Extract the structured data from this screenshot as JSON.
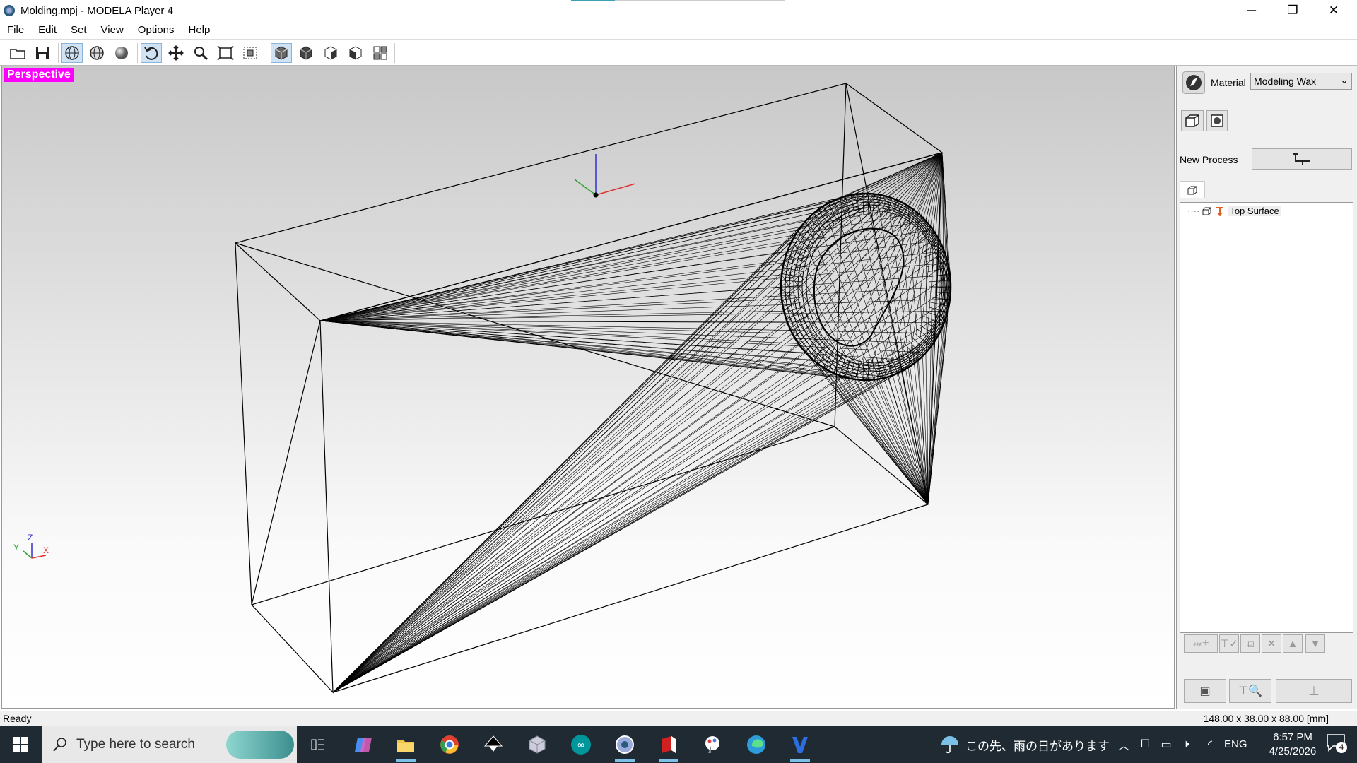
{
  "window": {
    "title": "Molding.mpj - MODELA Player 4",
    "minimize": "─",
    "restore": "❐",
    "close": "✕"
  },
  "menu": [
    "File",
    "Edit",
    "Set",
    "View",
    "Options",
    "Help"
  ],
  "toolbar": {
    "icons": [
      "open-folder-icon",
      "save-icon",
      "wireframe-icon",
      "hidden-line-icon",
      "shaded-icon",
      "rotate-icon",
      "pan-icon",
      "zoom-icon",
      "fit-view-icon",
      "zoom-window-icon",
      "view-front-icon",
      "view-side-icon",
      "view-back-icon",
      "view-other-icon",
      "multi-view-icon"
    ]
  },
  "viewport": {
    "mode_label": "Perspective",
    "axis_labels": {
      "y": "Y",
      "z": "Z",
      "x": "X"
    }
  },
  "panel": {
    "material_label": "Material",
    "material_value": "Modeling Wax",
    "new_process_label": "New Process",
    "process_tree": [
      {
        "label": "Top Surface"
      }
    ]
  },
  "status": {
    "left": "Ready",
    "right": "148.00 x 38.00 x 88.00 [mm]"
  },
  "taskbar": {
    "search_placeholder": "Type here to search",
    "weather_text": "この先、雨の日があります",
    "language": "ENG",
    "time": "6:57 PM",
    "date": "4/25/2026",
    "notification_count": "4"
  },
  "colors": {
    "perspective_badge": "#ff00ff",
    "taskbar": "#1f2a33",
    "axis_x": "#e03030",
    "axis_y": "#30a030",
    "axis_z": "#3030d0"
  }
}
